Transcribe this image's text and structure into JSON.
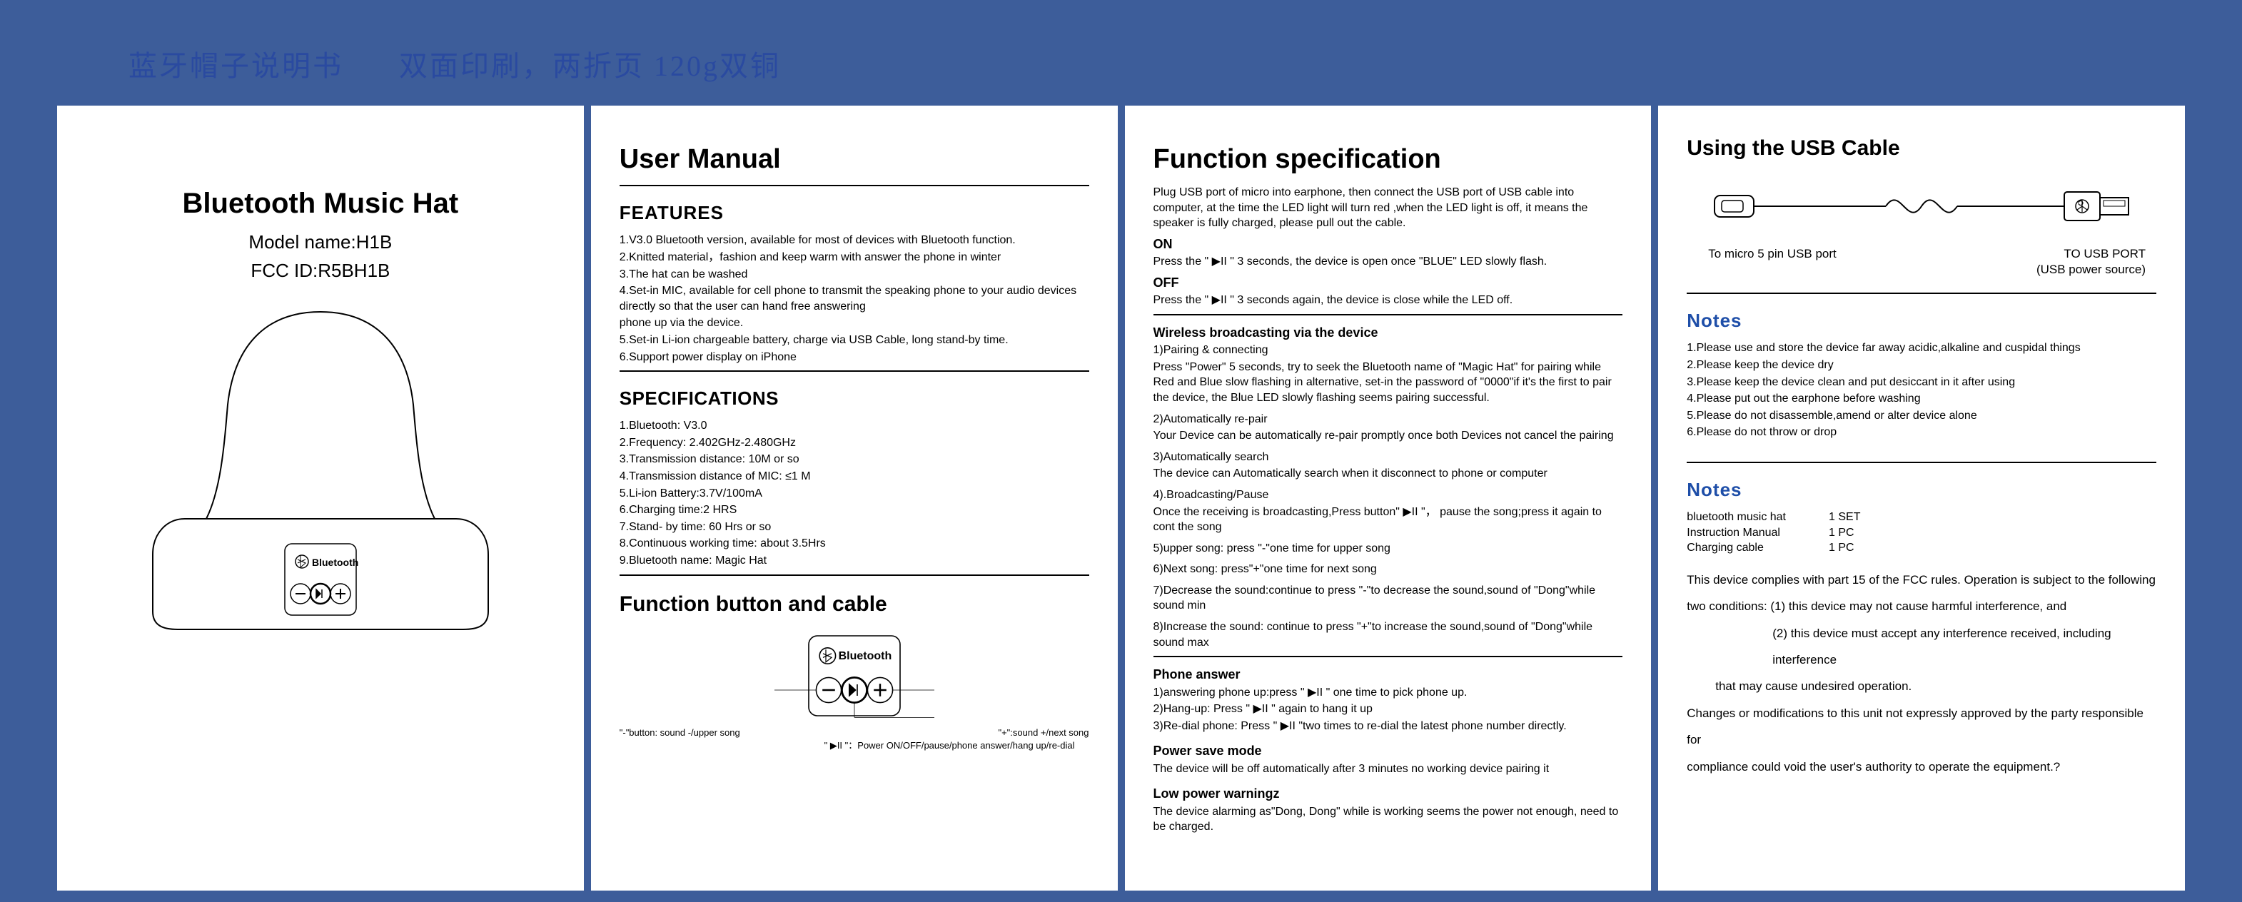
{
  "header_cn_1": "蓝牙帽子说明书",
  "header_cn_2": "双面印刷，两折页  120g双铜",
  "panel1": {
    "title": "Bluetooth Music Hat",
    "model": "Model name:H1B",
    "fcc": "FCC ID:R5BH1B",
    "bt_label": "Bluetooth"
  },
  "panel2": {
    "title": "User Manual",
    "features_h": "FEATURES",
    "features": [
      "1.V3.0 Bluetooth version, available for most of devices with Bluetooth function.",
      "2.Knitted material，fashion and keep warm with answer the phone in winter",
      "3.The hat can be washed",
      "4.Set-in MIC, available for cell phone to transmit the speaking phone to your audio devices directly so that the user can hand free answering",
      "phone up via the device.",
      "5.Set-in Li-ion chargeable battery, charge via USB Cable, long stand-by time.",
      "6.Support power display on iPhone"
    ],
    "specs_h": "SPECIFICATIONS",
    "specs": [
      "1.Bluetooth: V3.0",
      "2.Frequency: 2.402GHz-2.480GHz",
      "3.Transmission distance: 10M or so",
      "4.Transmission distance of MIC: ≤1 M",
      "5.Li-ion Battery:3.7V/100mA",
      "6.Charging time:2 HRS",
      "7.Stand- by time: 60 Hrs or so",
      "8.Continuous working time: about 3.5Hrs",
      "9.Bluetooth name: Magic Hat"
    ],
    "func_h": "Function button and cable",
    "bt_label": "Bluetooth",
    "minus_label": "\"-\"button:  sound -/upper song",
    "plus_label": "\"+\":sound +/next song",
    "play_label": "\" ▶II \"：Power ON/OFF/pause/phone answer/hang up/re-dial"
  },
  "panel3": {
    "title": "Function specification",
    "charge": "Plug USB port of micro into earphone, then connect the USB port of USB cable into computer, at the time the LED light will turn red ,when the LED light is off, it means the speaker is fully charged, please pull out the cable.",
    "on_h": "ON",
    "on_t": "Press the \" ▶II \" 3 seconds, the device is open once \"BLUE\" LED slowly flash.",
    "off_h": "OFF",
    "off_t": "Press the \" ▶II \" 3 seconds again, the device is close while the LED off.",
    "wb_h": "Wireless broadcasting via the device",
    "wb_1a": "1)Pairing & connecting",
    "wb_1b": "Press \"Power\" 5 seconds, try to seek the Bluetooth name of \"Magic Hat\" for pairing while Red and Blue slow flashing in alternative, set-in the password of \"0000\"if it's the first to pair the device, the Blue LED slowly flashing seems pairing successful.",
    "wb_2a": "2)Automatically re-pair",
    "wb_2b": "Your Device can be automatically re-pair promptly once both Devices not cancel the pairing",
    "wb_3a": "3)Automatically search",
    "wb_3b": "The device can Automatically search when it disconnect to phone or computer",
    "wb_4a": "4).Broadcasting/Pause",
    "wb_4b": "Once the receiving is broadcasting,Press button\" ▶II \"， pause the song;press it again to cont the song",
    "wb_5": "5)upper song: press \"-\"one time for upper song",
    "wb_6": "6)Next song:  press\"+\"one time for next song",
    "wb_7": "7)Decrease the sound:continue to press \"-\"to decrease the sound,sound of \"Dong\"while sound min",
    "wb_8": "8)Increase the sound: continue to press \"+\"to increase the sound,sound of \"Dong\"while sound max",
    "pa_h": "Phone answer",
    "pa_1": "1)answering phone up:press \" ▶II \" one time to pick phone up.",
    "pa_2": "2)Hang-up: Press \" ▶II \" again to hang it up",
    "pa_3": "3)Re-dial phone: Press \" ▶II \"two times to re-dial the latest phone number directly.",
    "psm_h": "Power save mode",
    "psm_t": "The device will be off automatically after 3 minutes no working device pairing it",
    "lpw_h": "Low power warningz",
    "lpw_t": "The device alarming as\"Dong, Dong\" while is working seems the power not enough, need to be charged."
  },
  "panel4": {
    "usb_h": "Using the USB Cable",
    "usb_l": "To micro 5 pin USB port",
    "usb_r1": "TO USB PORT",
    "usb_r2": "(USB power source)",
    "notes1_h": "Notes",
    "notes1": [
      "1.Please use and store the device far away acidic,alkaline and cuspidal things",
      "2.Please keep the device dry",
      "3.Please keep the device clean and put desiccant in it after using",
      "4.Please put out the earphone before washing",
      "5.Please do not disassemble,amend or alter device alone",
      "6.Please do not throw or drop"
    ],
    "notes2_h": "Notes",
    "contents_labels": [
      "bluetooth music hat",
      "Instruction Manual",
      "Charging cable"
    ],
    "contents_qty": [
      "1 SET",
      "1 PC",
      "1 PC"
    ],
    "fcc_1": "This device complies with part 15 of the FCC rules. Operation is subject to the following",
    "fcc_2": "two conditions: (1) this device may not cause harmful interference, and",
    "fcc_3": "(2) this device must accept any interference received, including interference",
    "fcc_4": "that may cause undesired operation.",
    "fcc_5": "Changes or modifications to this unit not expressly approved by the party responsible for",
    "fcc_6": "compliance could void the user's authority to operate the equipment.?"
  }
}
